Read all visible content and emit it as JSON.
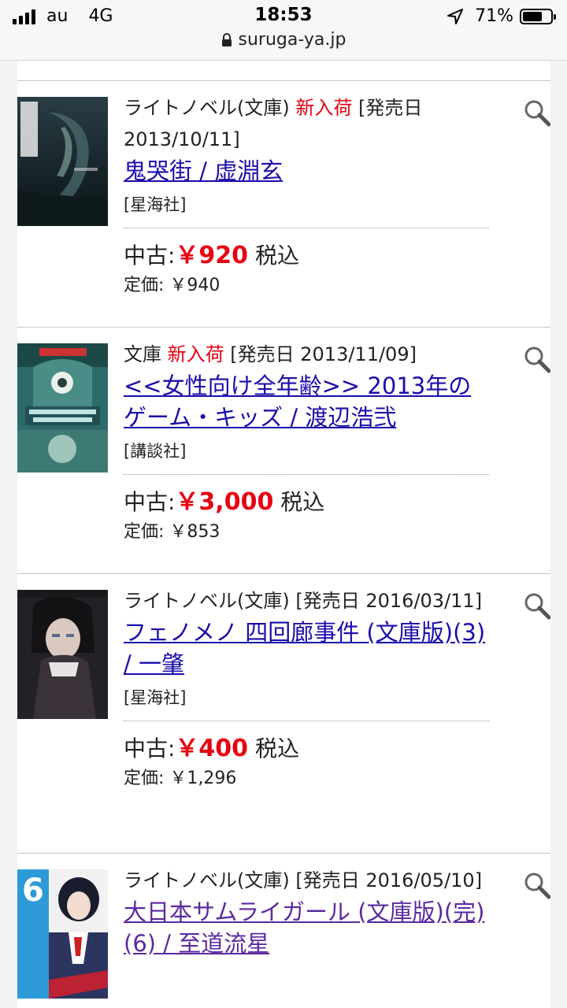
{
  "status": {
    "carrier": "au",
    "network": "4G",
    "time": "18:53",
    "battery_percent": "71%",
    "battery_level": 0.71
  },
  "url": "suruga-ya.jp",
  "items": [
    {
      "meta_prefix": "ライトノベル(文庫)",
      "badge": "新入荷",
      "meta_suffix": "[発売日 2013/10/11]",
      "title": "鬼哭街 / 虚淵玄",
      "publisher": "[星海社]",
      "price_label": "中古:",
      "price": "￥920",
      "tax": "税込",
      "list_price": "定価: ￥940"
    },
    {
      "meta_prefix": "文庫",
      "badge": "新入荷",
      "meta_suffix": "[発売日 2013/11/09]",
      "title": "<<女性向け全年齢>> 2013年のゲーム・キッズ / 渡辺浩弐",
      "publisher": "[講談社]",
      "price_label": "中古:",
      "price": "￥3,000",
      "tax": "税込",
      "list_price": "定価: ￥853"
    },
    {
      "meta_prefix": "ライトノベル(文庫)",
      "badge": "",
      "meta_suffix": "[発売日 2016/03/11]",
      "title": "フェノメノ 四回廊事件 (文庫版)(3) / 一肇",
      "publisher": "[星海社]",
      "price_label": "中古:",
      "price": "￥400",
      "tax": "税込",
      "list_price": "定価: ￥1,296"
    },
    {
      "meta_prefix": "ライトノベル(文庫)",
      "badge": "",
      "meta_suffix": "[発売日 2016/05/10]",
      "title": "大日本サムライガール (文庫版)(完)(6) / 至道流星",
      "publisher": "",
      "price_label": "",
      "price": "",
      "tax": "",
      "list_price": ""
    }
  ]
}
